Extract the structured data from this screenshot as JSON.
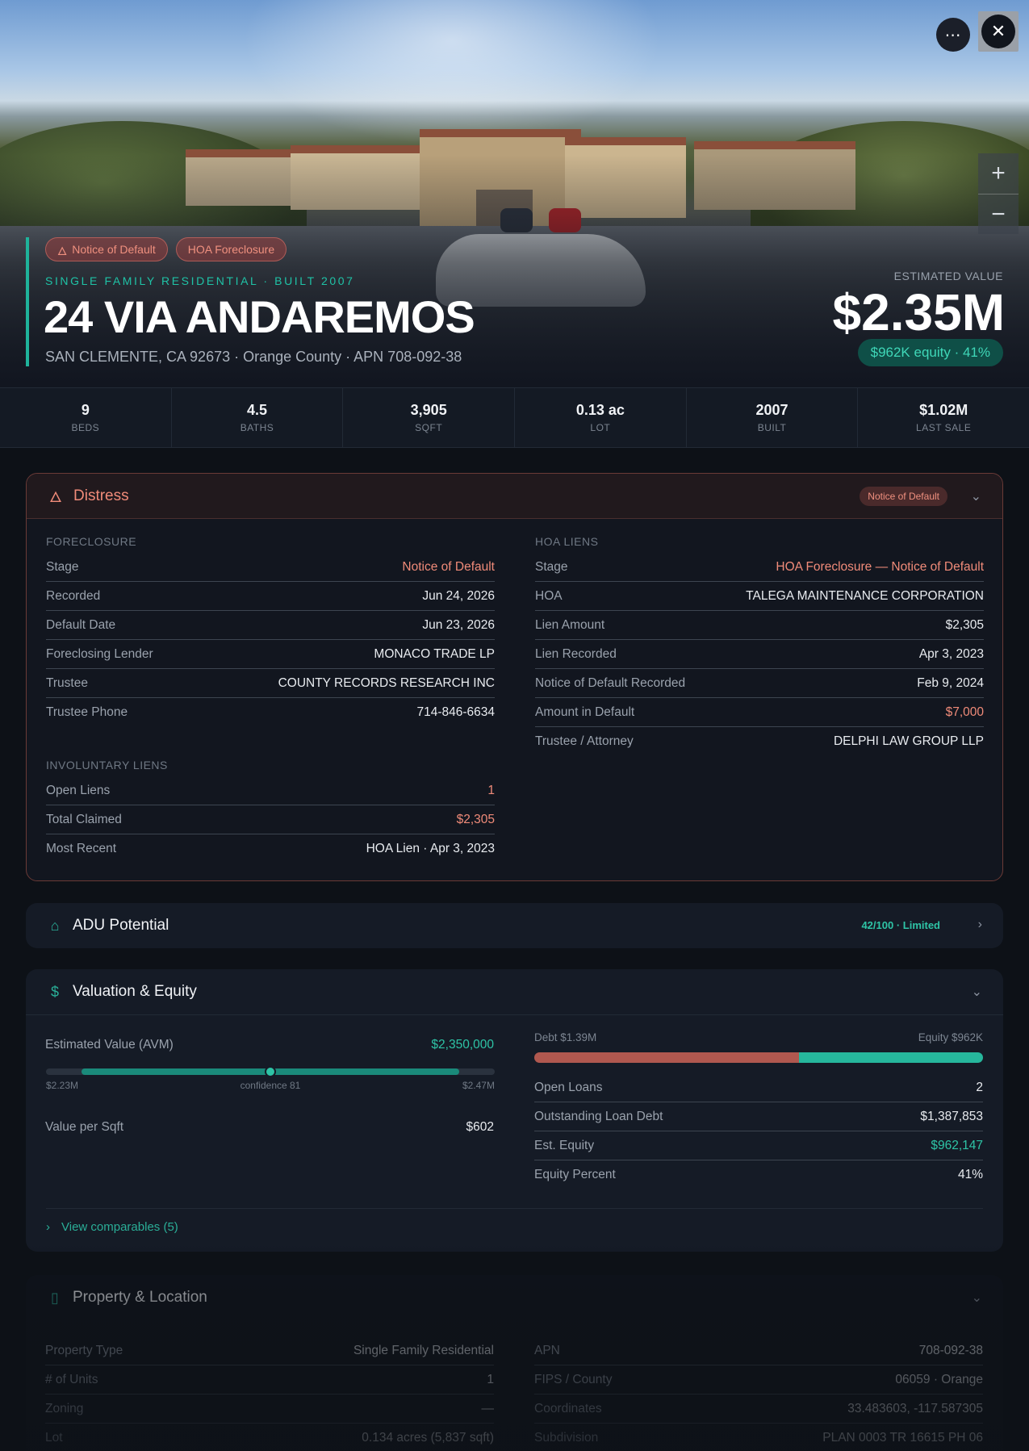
{
  "hero": {
    "badges": [
      {
        "label": "Notice of Default",
        "icon": "flame-icon"
      },
      {
        "label": "HOA Foreclosure"
      }
    ],
    "subtitle": "SINGLE FAMILY RESIDENTIAL · BUILT 2007",
    "address": "24 VIA ANDAREMOS",
    "location": "SAN CLEMENTE, CA 92673 · Orange County · APN 708-092-38",
    "estimated_value_label": "ESTIMATED VALUE",
    "estimated_value": "$2.35M",
    "equity": "$962K equity · 41%",
    "controls": {
      "more": "⋯",
      "close": "✕",
      "zoom_in": "+",
      "zoom_out": "−"
    }
  },
  "stats": [
    {
      "value": "9",
      "label": "BEDS"
    },
    {
      "value": "4.5",
      "label": "BATHS"
    },
    {
      "value": "3,905",
      "label": "SQFT"
    },
    {
      "value": "0.13 ac",
      "label": "LOT"
    },
    {
      "value": "2007",
      "label": "BUILT"
    },
    {
      "value": "$1.02M",
      "label": "LAST SALE"
    }
  ],
  "distress": {
    "title": "Distress",
    "badge": "Notice of Default",
    "foreclosure": {
      "label": "FORECLOSURE",
      "rows": [
        {
          "k": "Stage",
          "v": "Notice of Default"
        },
        {
          "k": "Recorded",
          "v": "Jun 24, 2026"
        },
        {
          "k": "Default Date",
          "v": "Jun 23, 2026"
        },
        {
          "k": "Foreclosing Lender",
          "v": "MONACO TRADE LP"
        },
        {
          "k": "Trustee",
          "v": "COUNTY RECORDS RESEARCH INC"
        },
        {
          "k": "Trustee Phone",
          "v": "714-846-6634"
        }
      ]
    },
    "involuntary": {
      "label": "INVOLUNTARY LIENS",
      "rows": [
        {
          "k": "Open Liens",
          "v": "1"
        },
        {
          "k": "Total Claimed",
          "v": "$2,305"
        },
        {
          "k": "Most Recent",
          "v": "HOA Lien · Apr 3, 2023"
        }
      ]
    },
    "hoa": {
      "label": "HOA LIENS",
      "rows": [
        {
          "k": "Stage",
          "v": "HOA Foreclosure — Notice of Default"
        },
        {
          "k": "HOA",
          "v": "TALEGA MAINTENANCE CORPORATION"
        },
        {
          "k": "Lien Amount",
          "v": "$2,305"
        },
        {
          "k": "Lien Recorded",
          "v": "Apr 3, 2023"
        },
        {
          "k": "Notice of Default Recorded",
          "v": "Feb 9, 2024"
        },
        {
          "k": "Amount in Default",
          "v": "$7,000"
        },
        {
          "k": "Trustee / Attorney",
          "v": "DELPHI LAW GROUP LLP"
        }
      ]
    }
  },
  "adu": {
    "title": "ADU Potential",
    "badge": "42/100 · Limited"
  },
  "valuation": {
    "title": "Valuation & Equity",
    "avm": {
      "k": "Estimated Value (AVM)",
      "v": "$2,350,000"
    },
    "range": {
      "low": "$2.23M",
      "mid": "confidence 81",
      "high": "$2.47M",
      "low_value": 2.23,
      "high_value": 2.47,
      "estimate": 2.35
    },
    "per_sqft": {
      "k": "Value per Sqft",
      "v": "$602"
    },
    "debt_label": "Debt $1.39M",
    "equity_label": "Equity $962K",
    "debt_fraction": 0.59,
    "right_rows": [
      {
        "k": "Open Loans",
        "v": "2"
      },
      {
        "k": "Outstanding Loan Debt",
        "v": "$1,387,853"
      },
      {
        "k": "Est. Equity",
        "v": "$962,147"
      },
      {
        "k": "Equity Percent",
        "v": "41%"
      }
    ],
    "comparables": "View comparables (5)"
  },
  "property": {
    "title": "Property & Location",
    "left_rows": [
      {
        "k": "Property Type",
        "v": "Single Family Residential"
      },
      {
        "k": "# of Units",
        "v": "1"
      },
      {
        "k": "Zoning",
        "v": "—"
      },
      {
        "k": "Lot",
        "v": "0.134 acres (5,837 sqft)"
      }
    ],
    "right_rows": [
      {
        "k": "APN",
        "v": "708-092-38"
      },
      {
        "k": "FIPS / County",
        "v": "06059 · Orange"
      },
      {
        "k": "Coordinates",
        "v": "33.483603, -117.587305"
      },
      {
        "k": "Subdivision",
        "v": "PLAN 0003 TR 16615 PH 06"
      }
    ]
  },
  "colors": {
    "accent": "#1fc2a6",
    "danger": "#f08b79",
    "background": "#0d1117"
  }
}
